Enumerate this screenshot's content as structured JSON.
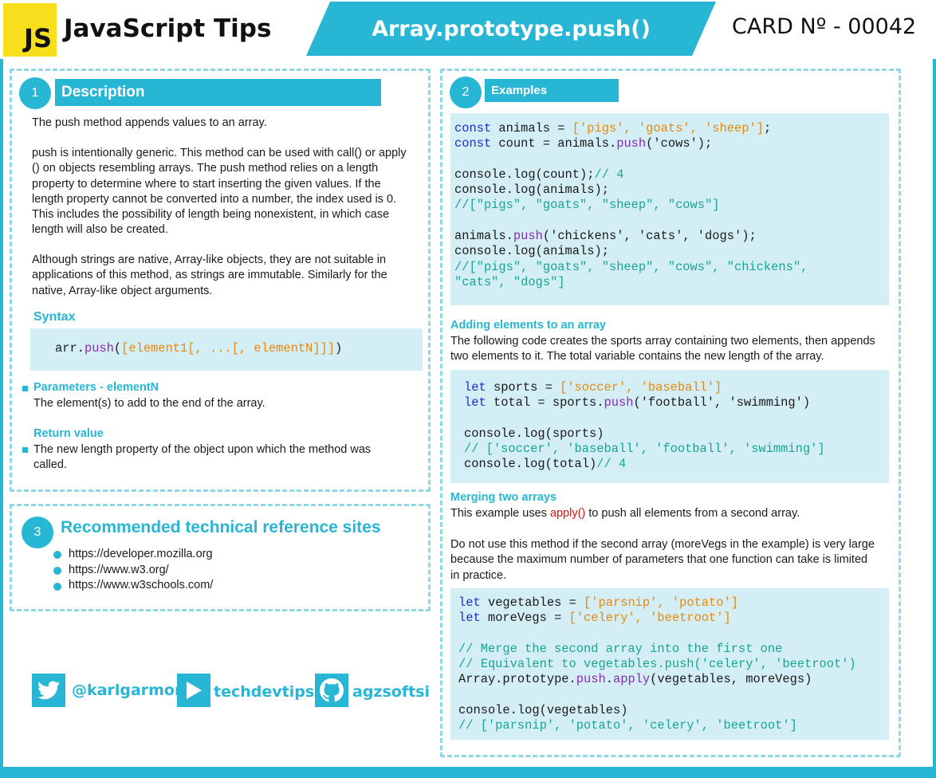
{
  "header": {
    "logo": "JS",
    "title": "JavaScript Tips",
    "banner": "Array.prototype.push()",
    "card_number": "CARD Nº - 00042"
  },
  "colors": {
    "accent": "#27b6d4",
    "logo_bg": "#f7df1e",
    "code_bg": "#d4eef5"
  },
  "description": {
    "number": "1",
    "heading": "Description",
    "p1": "The push method appends values to an array.",
    "p2": [
      "push is intentionally generic. This method can be used with call() or apply",
      "() on objects resembling arrays. The push method relies on a length",
      "property to determine where to start inserting the given values. If the",
      "length property cannot be converted into a number, the index used is 0.",
      "This includes the possibility of length being nonexistent, in which case",
      "length will also be created."
    ],
    "p3": [
      "Although strings are native, Array-like objects, they are not suitable in",
      "applications of this method, as strings are immutable.  Similarly for the",
      "native, Array-like object arguments."
    ],
    "syntax_heading": "Syntax",
    "syntax_code": "arr.push([element1[, ...[, elementN]]])",
    "params_heading": "Parameters - elementN",
    "params_text": "The element(s) to add to the end of the array.",
    "return_heading": "Return value",
    "return_text": [
      "The new length property of the object upon which the method was",
      "called."
    ]
  },
  "examples": {
    "number": "2",
    "heading": "Examples",
    "code1": [
      "const animals = ['pigs', 'goats', 'sheep'];",
      "const count = animals.push('cows');",
      "",
      "console.log(count);// 4",
      "console.log(animals);",
      "//[\"pigs\", \"goats\", \"sheep\", \"cows\"]",
      "",
      "animals.push('chickens', 'cats', 'dogs');",
      "console.log(animals);",
      "//[\"pigs\", \"goats\", \"sheep\", \"cows\", \"chickens\",",
      "\"cats\", \"dogs\"]"
    ],
    "adding_heading": "Adding elements to an array",
    "adding_text": [
      "The following code creates the sports array containing two elements, then appends",
      "two elements to it. The total variable contains the new length of the array."
    ],
    "code2": [
      "let sports = ['soccer', 'baseball']",
      "let total = sports.push('football', 'swimming')",
      "",
      "console.log(sports)",
      "// ['soccer', 'baseball', 'football', 'swimming']",
      "console.log(total)// 4"
    ],
    "merging_heading": "Merging two arrays",
    "merging_text_before": "This example uses ",
    "merging_text_red": "apply()",
    "merging_text_after": " to push all elements from a second array.",
    "merging_warning": [
      "Do not use this method if the second array (moreVegs in the example) is very large",
      "because the maximum number of parameters that one function can take is limited",
      "in practice."
    ],
    "code3": [
      "let vegetables = ['parsnip', 'potato']",
      "let moreVegs = ['celery', 'beetroot']",
      "",
      "// Merge the second array into the first one",
      "// Equivalent to vegetables.push('celery', 'beetroot')",
      "Array.prototype.push.apply(vegetables, moreVegs)",
      "",
      "console.log(vegetables)",
      "// ['parsnip', 'potato', 'celery', 'beetroot']"
    ]
  },
  "references": {
    "number": "3",
    "heading": "Recommended technical reference sites",
    "sites": [
      "https://developer.mozilla.org",
      "https://www.w3.org/",
      "https://www.w3schools.com/"
    ]
  },
  "social": {
    "twitter": "@karlgarmor",
    "youtube": "techdevtips",
    "github": "agzsoftsi"
  }
}
